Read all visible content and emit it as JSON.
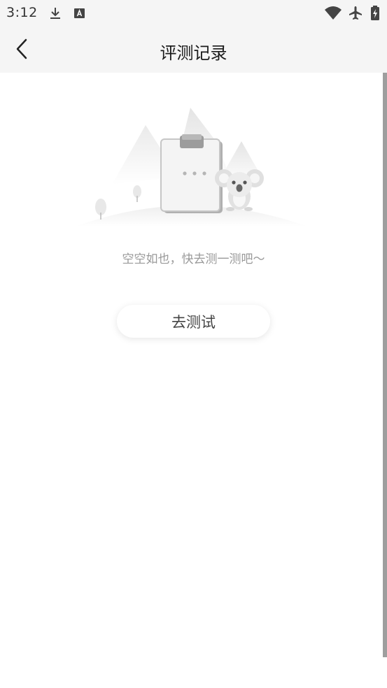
{
  "status_bar": {
    "time": "3:12",
    "icons": [
      "download-icon",
      "a-notification-icon",
      "wifi-icon",
      "airplane-icon",
      "battery-charging-icon"
    ]
  },
  "nav": {
    "back_icon": "chevron-left-icon",
    "title": "评测记录"
  },
  "empty_state": {
    "illustration": "koala-clipboard-illustration",
    "message": "空空如也，快去测一测吧～"
  },
  "actions": {
    "go_test_label": "去测试"
  },
  "colors": {
    "header_bg": "#f5f5f5",
    "background": "#ffffff",
    "hint_text": "#999999",
    "title_text": "#1a1a1a"
  }
}
